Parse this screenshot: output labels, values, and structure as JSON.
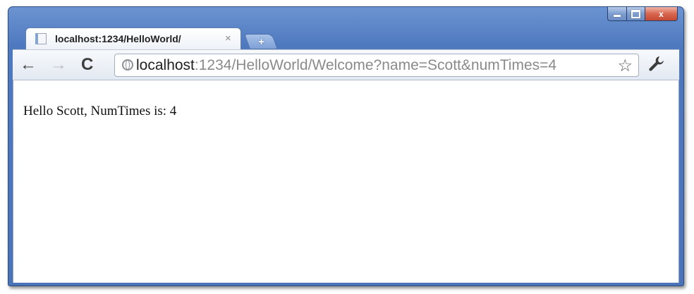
{
  "window": {
    "controls": {
      "minimize_icon": "minimize-icon",
      "maximize_icon": "maximize-icon",
      "close_label": "x"
    }
  },
  "tab": {
    "title": "localhost:1234/HelloWorld/",
    "close_label": "×",
    "favicon": "page-icon"
  },
  "new_tab": {
    "label": "+"
  },
  "toolbar": {
    "back_label": "←",
    "forward_label": "→",
    "reload_label": "C",
    "star_label": "☆",
    "wrench_icon": "wrench-icon"
  },
  "omnibox": {
    "url_host": "localhost",
    "url_rest": ":1234/HelloWorld/Welcome?name=Scott&numTimes=4"
  },
  "page": {
    "text": "Hello Scott, NumTimes is: 4"
  }
}
